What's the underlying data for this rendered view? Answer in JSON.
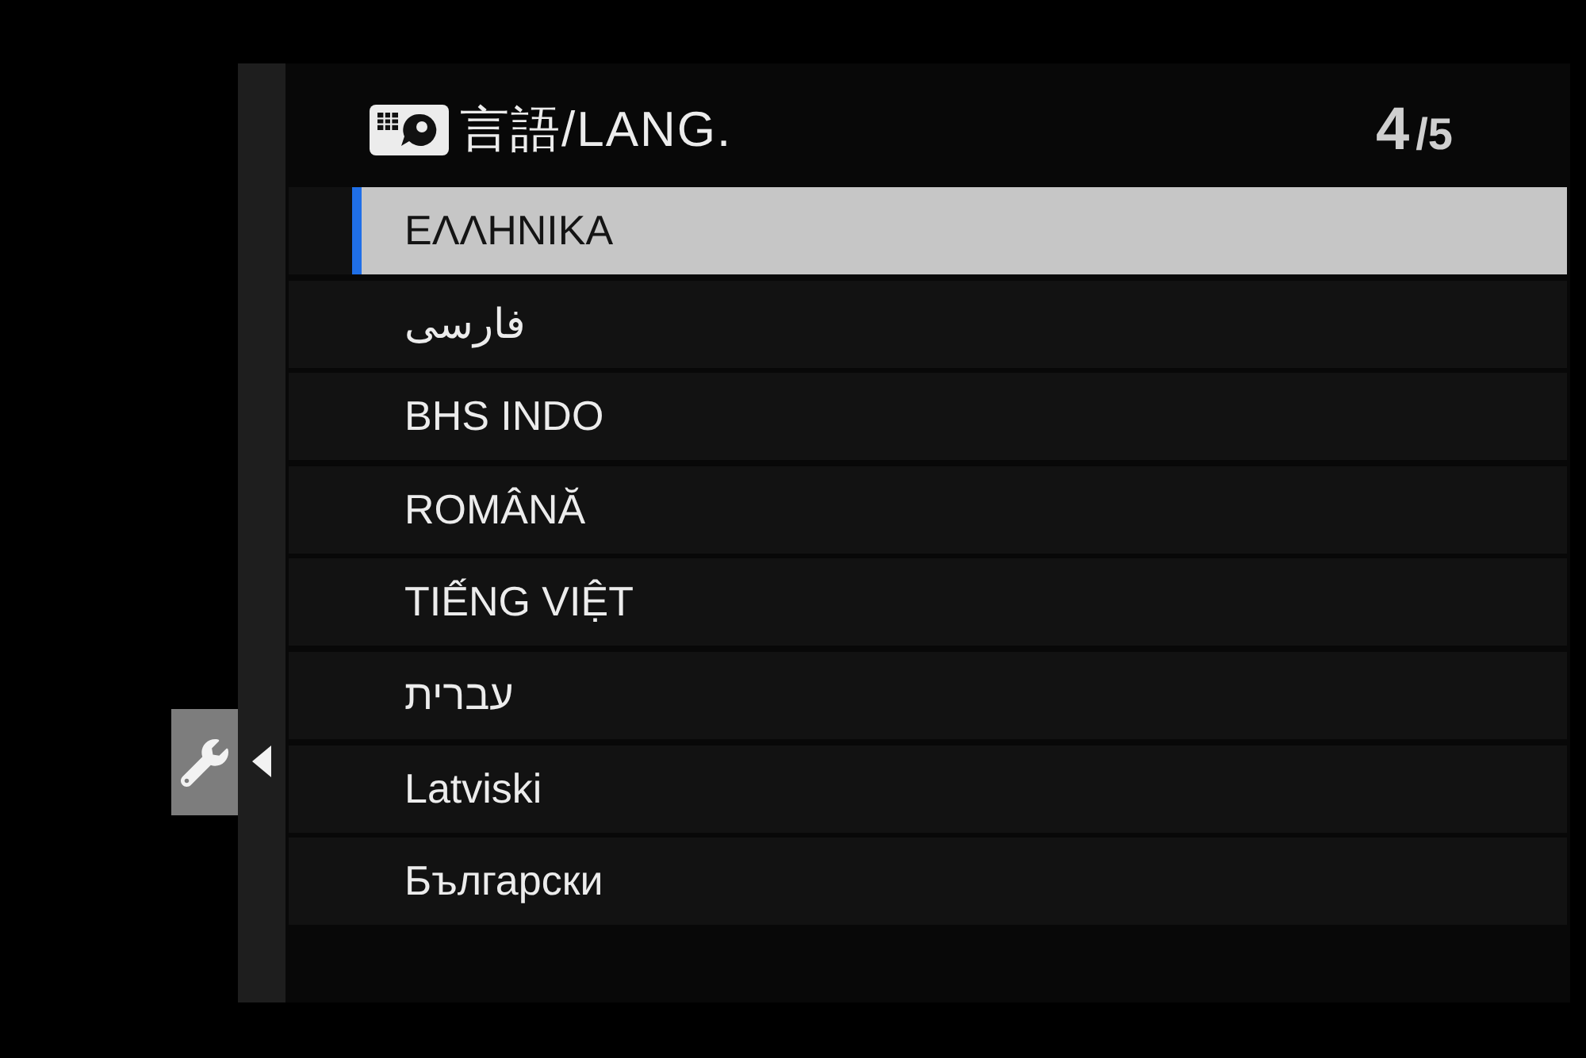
{
  "side_tabs": [
    {
      "selected": true
    }
  ],
  "header": {
    "title": "言語/LANG.",
    "page_current": "4",
    "page_rest": "/5"
  },
  "languages": [
    {
      "label": "ΕΛΛΗΝΙΚΑ",
      "selected": true
    },
    {
      "label": "فارسی",
      "selected": false
    },
    {
      "label": "BHS INDO",
      "selected": false
    },
    {
      "label": "ROMÂNĂ",
      "selected": false
    },
    {
      "label": "TIẾNG VIỆT",
      "selected": false
    },
    {
      "label": "עברית",
      "selected": false
    },
    {
      "label": "Latviski",
      "selected": false
    },
    {
      "label": "Български",
      "selected": false
    }
  ]
}
